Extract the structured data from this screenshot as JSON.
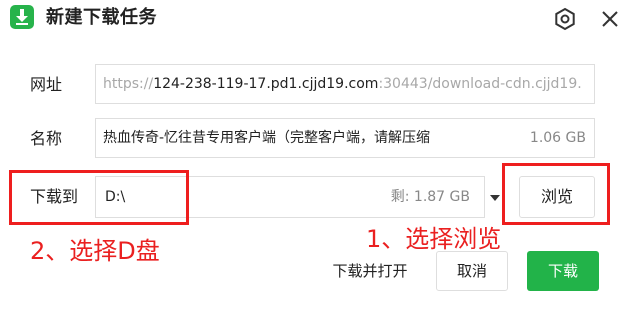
{
  "dialog": {
    "title": "新建下载任务",
    "icons": {
      "app": "download-app-icon",
      "settings": "settings-icon",
      "close": "close-icon"
    }
  },
  "form": {
    "url_label": "网址",
    "url_prefix": "https://",
    "url_host": "124-238-119-17.pd1.cjjd19.com",
    "url_rest": ":30443/download-cdn.cjjd19.",
    "name_label": "名称",
    "filename": "热血传奇-忆往昔专用客户端（完整客户端，请解压缩",
    "file_size": "1.06 GB",
    "path_label": "下载到",
    "path_value": "D:\\",
    "free_space": "剩: 1.87 GB",
    "browse_label": "浏览"
  },
  "annotations": {
    "step1": "1、选择浏览",
    "step2": "2、选择D盘",
    "highlight_color": "#ee1e1e"
  },
  "actions": {
    "open_after": "下载并打开",
    "cancel": "取消",
    "download": "下载",
    "accent_color": "#22b349"
  }
}
